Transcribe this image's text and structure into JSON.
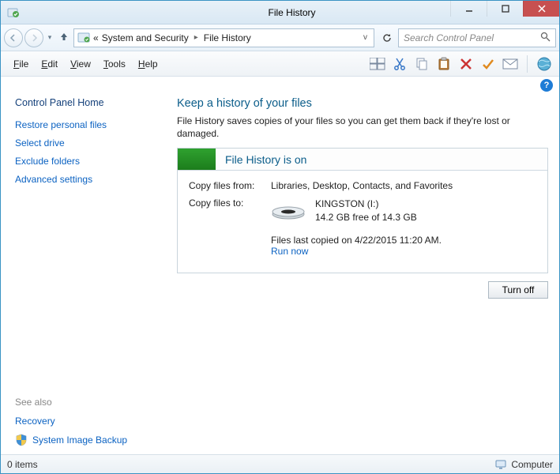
{
  "window": {
    "title": "File History"
  },
  "nav": {
    "breadcrumb_prefix": "«",
    "crumbs": [
      "System and Security",
      "File History"
    ],
    "search_placeholder": "Search Control Panel"
  },
  "menu": {
    "items": [
      "File",
      "Edit",
      "View",
      "Tools",
      "Help"
    ]
  },
  "sidebar": {
    "home": "Control Panel Home",
    "links": [
      "Restore personal files",
      "Select drive",
      "Exclude folders",
      "Advanced settings"
    ],
    "see_also": "See also",
    "recovery": "Recovery",
    "system_image_backup": "System Image Backup"
  },
  "main": {
    "heading": "Keep a history of your files",
    "description": "File History saves copies of your files so you can get them back if they're lost or damaged.",
    "status_title": "File History is on",
    "copy_from_label": "Copy files from:",
    "copy_from_value": "Libraries, Desktop, Contacts, and Favorites",
    "copy_to_label": "Copy files to:",
    "drive_name": "KINGSTON (I:)",
    "drive_free": "14.2 GB free of 14.3 GB",
    "last_copied": "Files last copied on 4/22/2015 11:20 AM.",
    "run_now": "Run now",
    "turn_off": "Turn off"
  },
  "statusbar": {
    "left": "0 items",
    "right": "Computer"
  }
}
